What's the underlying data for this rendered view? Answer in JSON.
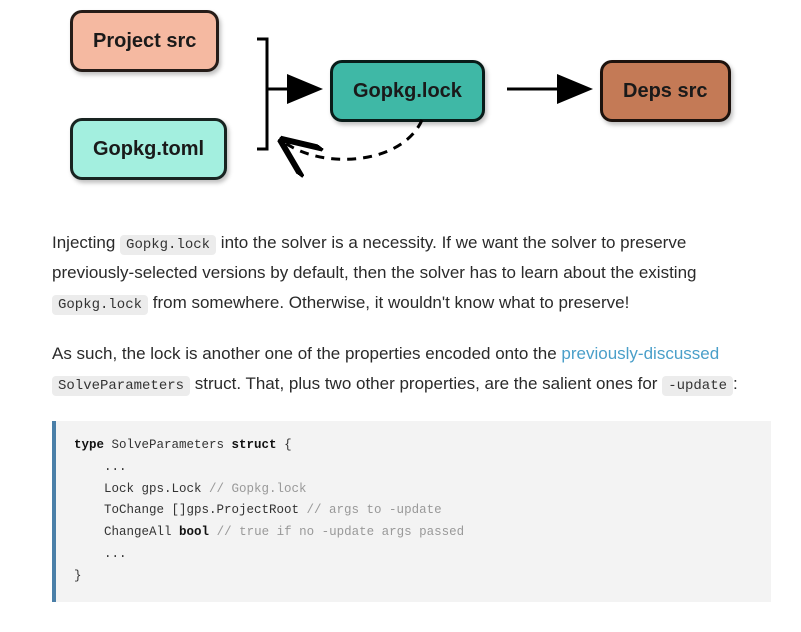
{
  "diagram": {
    "project_src": "Project src",
    "gopkg_toml": "Gopkg.toml",
    "gopkg_lock": "Gopkg.lock",
    "deps_src": "Deps src"
  },
  "para1": {
    "t1": "Injecting ",
    "c1": "Gopkg.lock",
    "t2": " into the solver is a necessity. If we want the solver to preserve previously-selected versions by default, then the solver has to learn about the existing ",
    "c2": "Gopkg.lock",
    "t3": " from somewhere. Otherwise, it wouldn't know what to preserve!"
  },
  "para2": {
    "t1": "As such, the lock is another one of the properties encoded onto the ",
    "link": "previously-discussed",
    "t2": " ",
    "c1": "SolveParameters",
    "t3": " struct. That, plus two other properties, are the salient ones for ",
    "c2": "-update",
    "t4": ":"
  },
  "code": {
    "kw_type": "type",
    "ident": " SolveParameters ",
    "kw_struct": "struct",
    "brace_open": " {",
    "l_dots1": "    ...",
    "l_lock": "    Lock gps.Lock ",
    "cm_lock": "// Gopkg.lock",
    "l_tochange": "    ToChange []gps.ProjectRoot ",
    "cm_tochange": "// args to -update",
    "l_changeall_pre": "    ChangeAll ",
    "kw_bool": "bool",
    "l_changeall_post": " ",
    "cm_changeall": "// true if no -update args passed",
    "l_dots2": "    ...",
    "brace_close": "}"
  }
}
